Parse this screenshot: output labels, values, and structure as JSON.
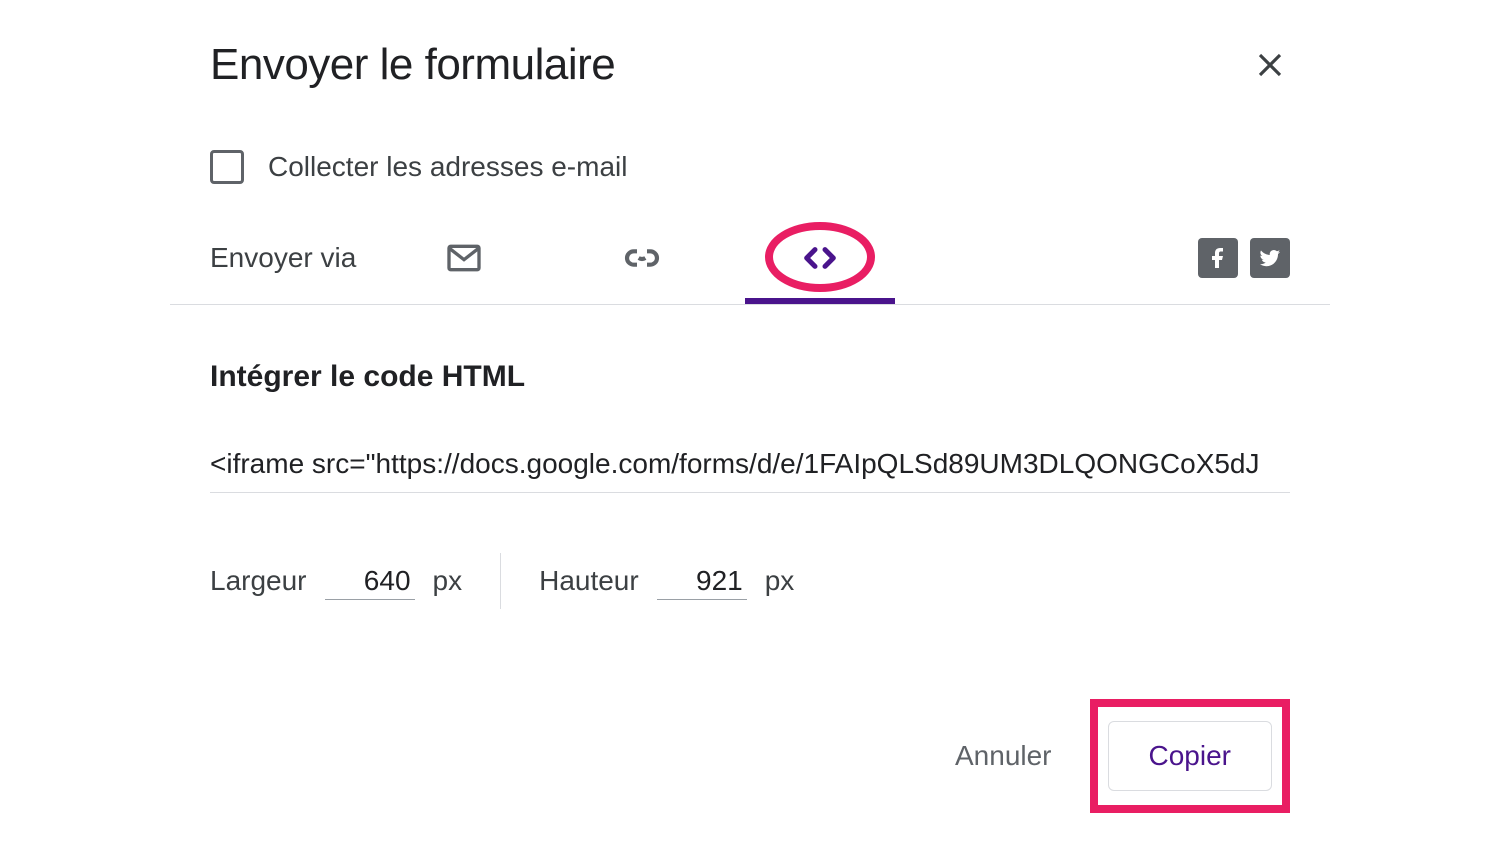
{
  "dialog": {
    "title": "Envoyer le formulaire",
    "close_icon": "close"
  },
  "collect": {
    "checked": false,
    "label": "Collecter les adresses e-mail"
  },
  "send_via": {
    "label": "Envoyer via",
    "tabs": {
      "email": {
        "icon": "mail-icon"
      },
      "link": {
        "icon": "link-icon"
      },
      "embed": {
        "icon": "code-icon",
        "active": true
      }
    },
    "social": {
      "facebook": "facebook-icon",
      "twitter": "twitter-icon"
    }
  },
  "embed": {
    "section_title": "Intégrer le code HTML",
    "code": "<iframe src=\"https://docs.google.com/forms/d/e/1FAIpQLSd89UM3DLQONGCoX5dJ",
    "width_label": "Largeur",
    "width_value": "640",
    "width_unit": "px",
    "height_label": "Hauteur",
    "height_value": "921",
    "height_unit": "px"
  },
  "actions": {
    "cancel": "Annuler",
    "copy": "Copier"
  },
  "annotations": {
    "highlight_color": "#e91e63",
    "active_tab_color": "#4a148c"
  }
}
